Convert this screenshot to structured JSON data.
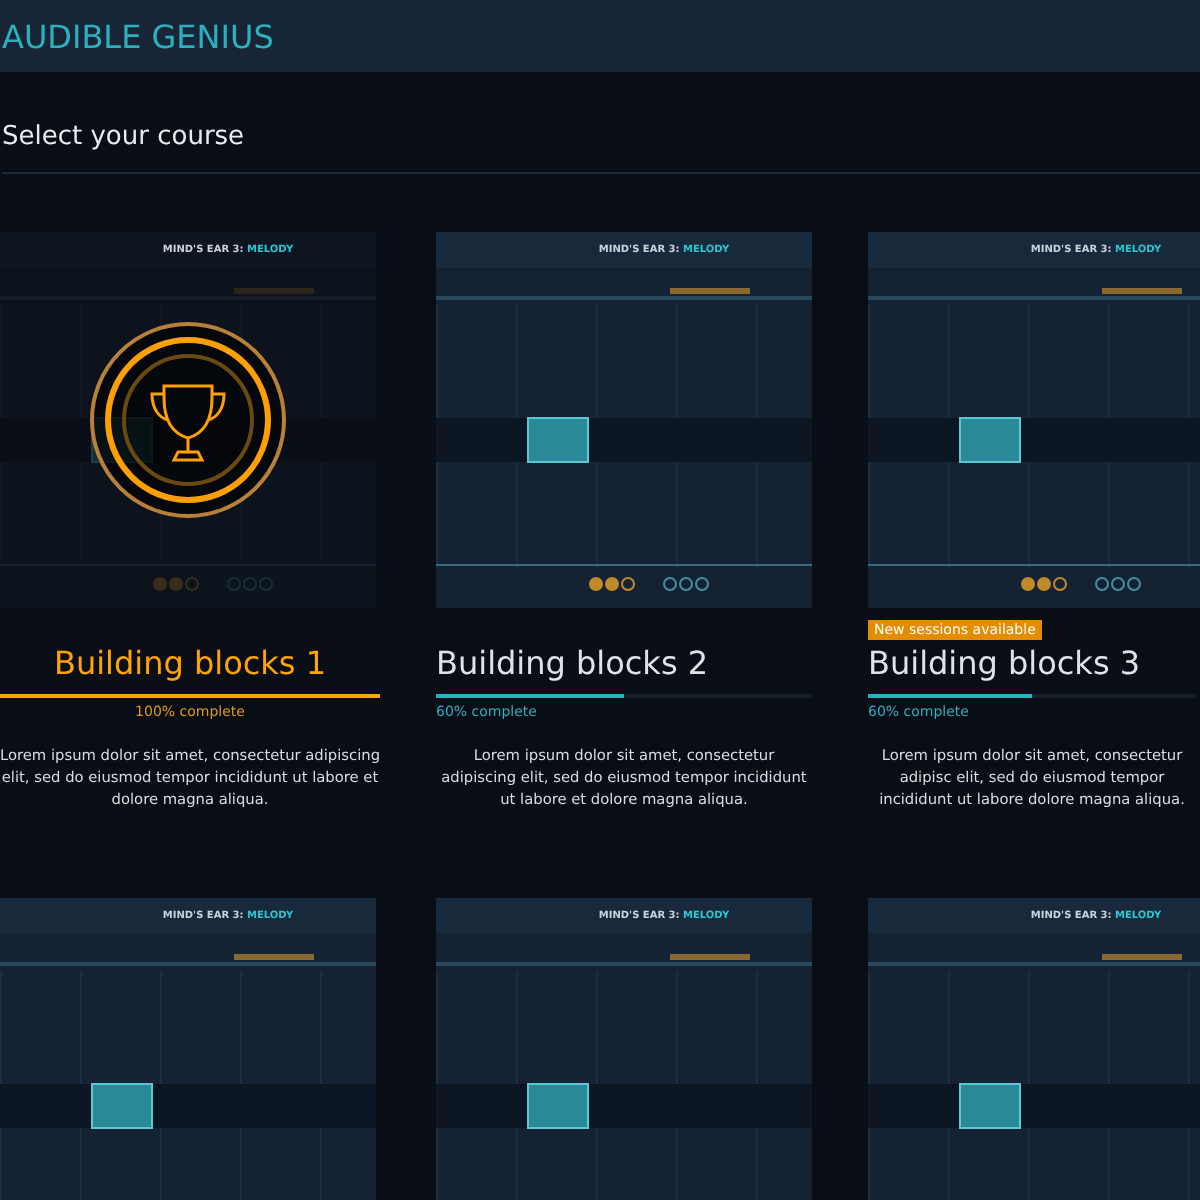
{
  "header": {
    "title": "AUDIBLE GENIUS"
  },
  "page_title": "Select your course",
  "courses": [
    {
      "completed": true,
      "title": "Building blocks 1",
      "progress_text": "100% complete",
      "level": 1,
      "description": "Lorem ipsum dolor sit amet, consectetur adipiscing elit, sed do eiusmod tempor incididunt ut labore et dolore magna aliqua.",
      "thumb_title": "MIND'S EAR 3:",
      "thumb_subtitle": "MELODY"
    },
    {
      "completed": false,
      "title": "Building blocks 2",
      "progress_text": "60% complete",
      "level": 0.5,
      "description": "Lorem ipsum dolor sit amet, consectetur adipiscing elit, sed do eiusmod tempor incididunt ut labore et dolore magna aliqua.",
      "thumb_title": "MIND'S EAR 3:",
      "thumb_subtitle": "MELODY"
    },
    {
      "completed": false,
      "badge": "New sessions available",
      "title": "Building blocks 3",
      "progress_text": "60% complete",
      "level": 0.5,
      "description": "Lorem ipsum dolor sit amet, consectetur adipisc elit, sed do eiusmod tempor incididunt ut labore dolore magna aliqua.",
      "thumb_title": "MIND'S EAR 3:",
      "thumb_subtitle": "MELODY"
    },
    {
      "thumb_title": "MIND'S EAR 3:",
      "thumb_subtitle": "MELODY"
    },
    {
      "thumb_title": "MIND'S EAR 3:",
      "thumb_subtitle": "MELODY"
    },
    {
      "thumb_title": "MIND'S EAR 3:",
      "thumb_subtitle": "MELODY"
    }
  ]
}
